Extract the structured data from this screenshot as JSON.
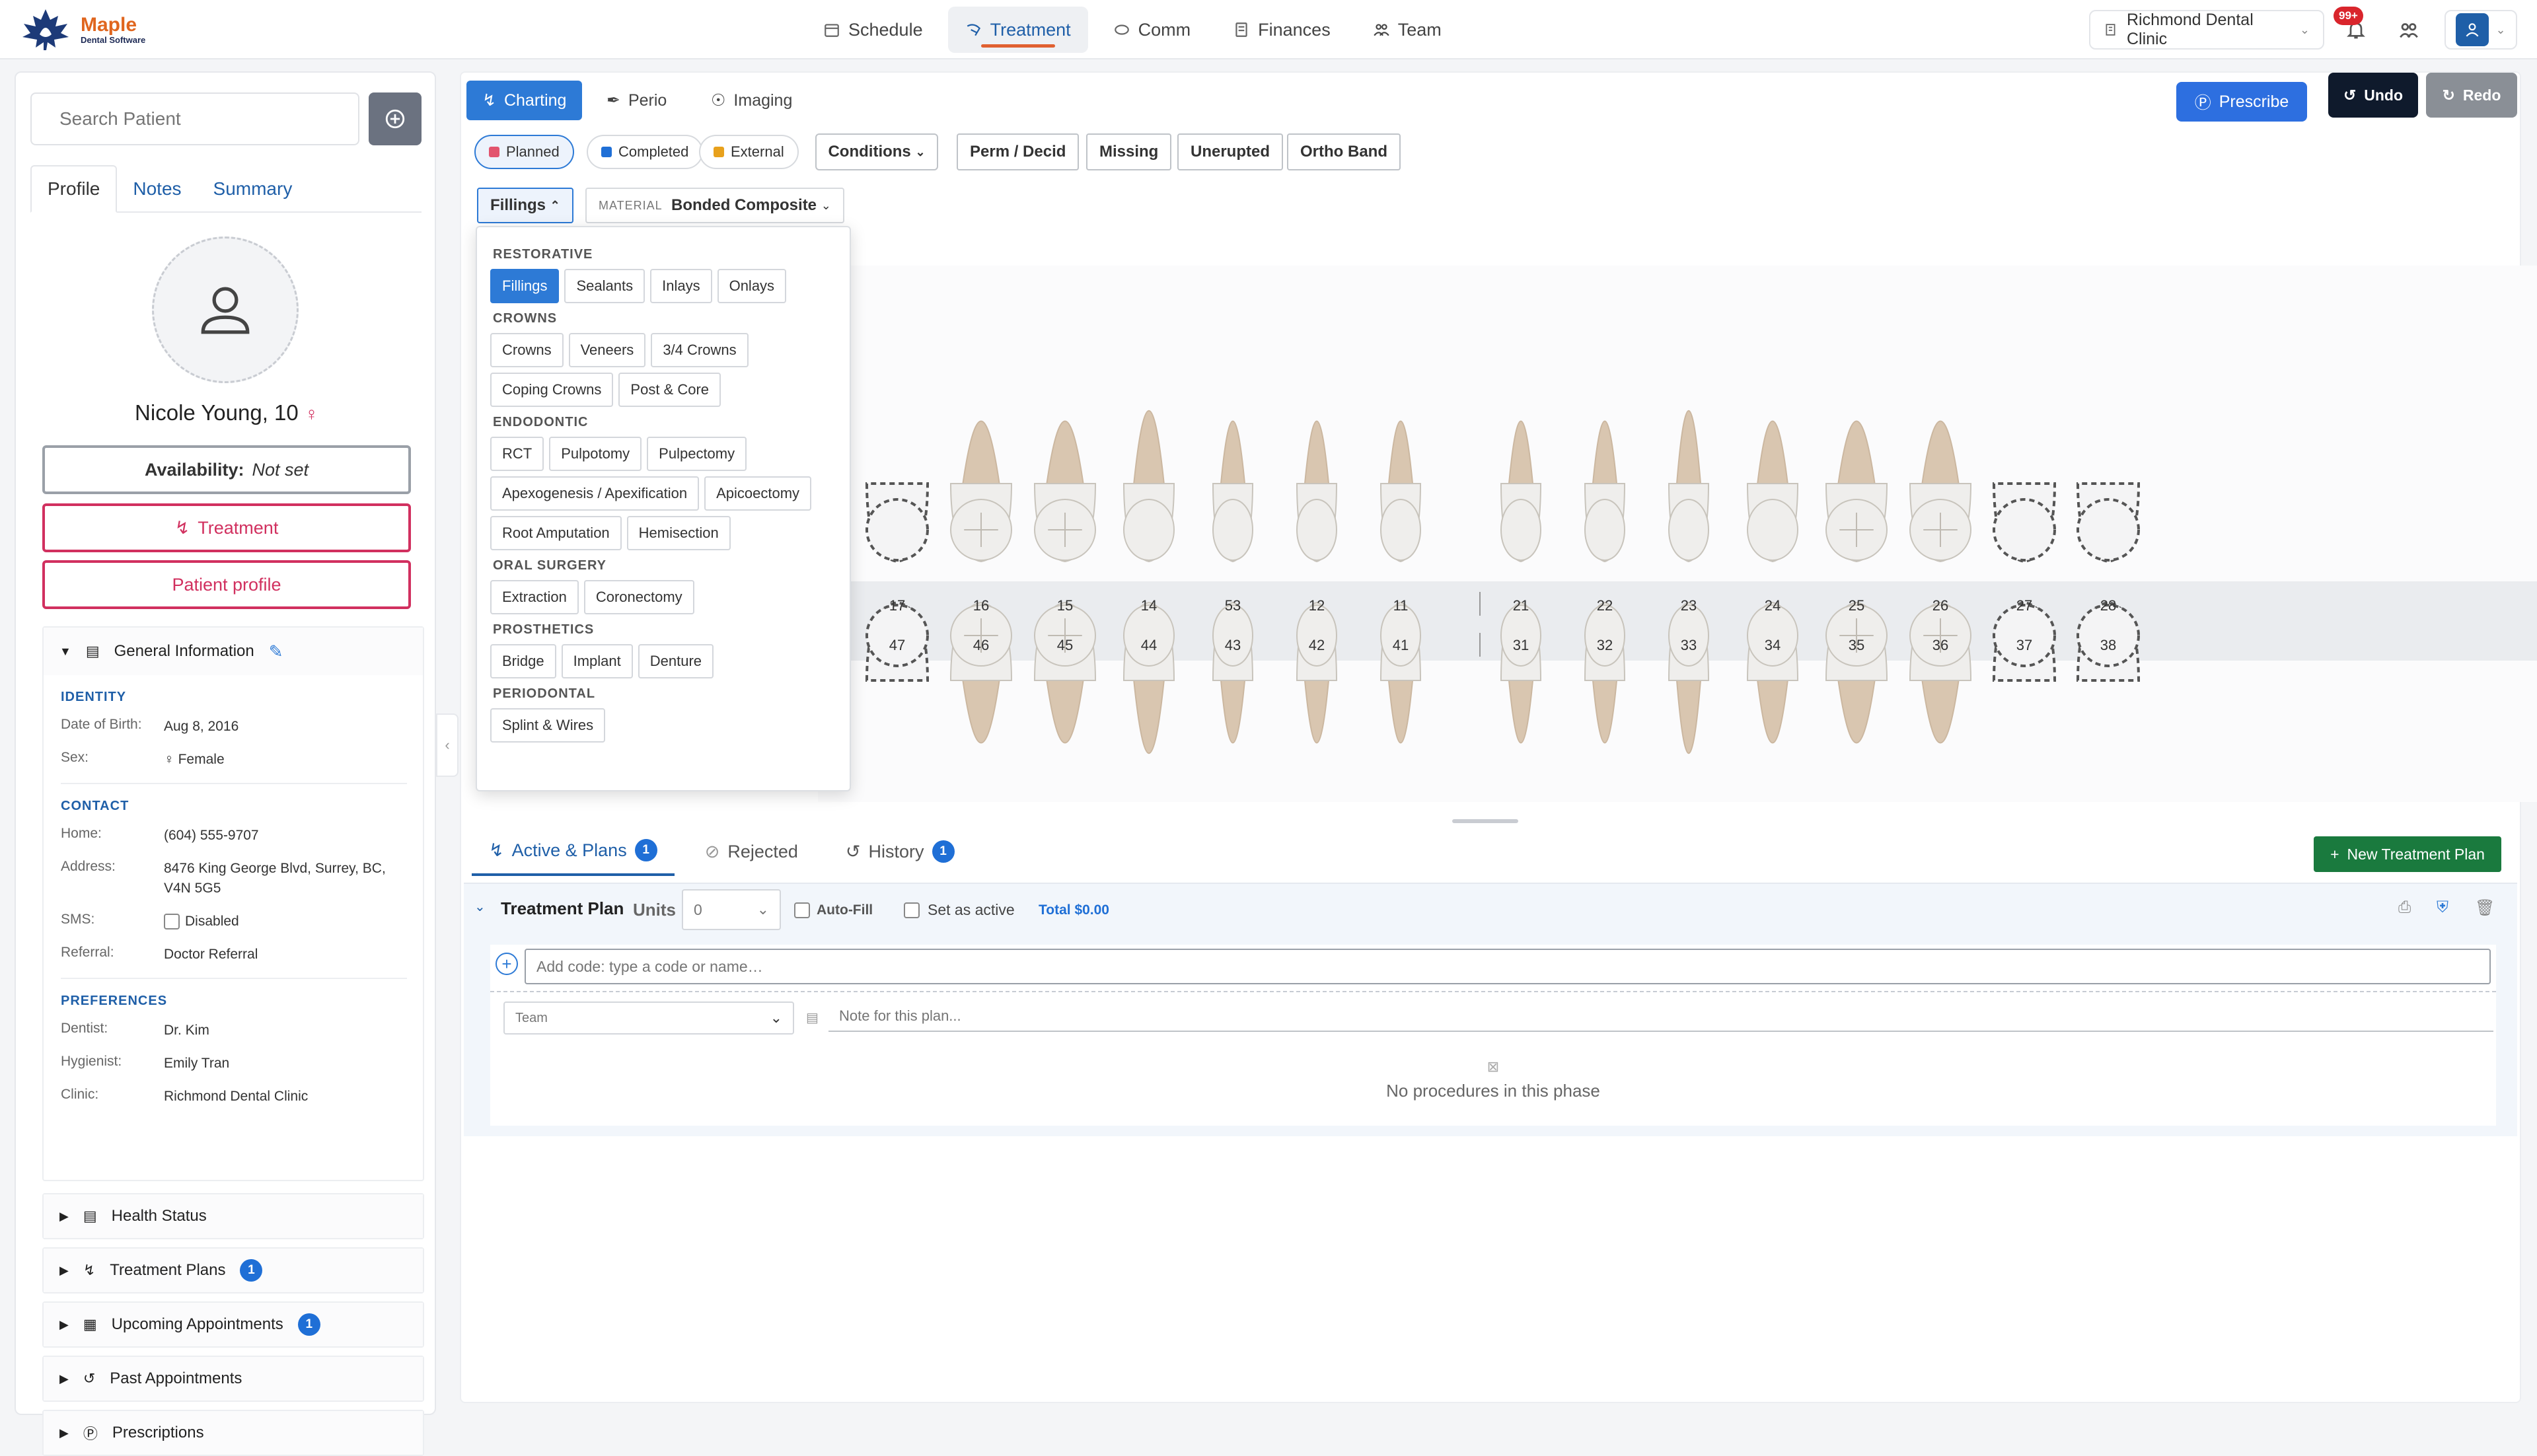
{
  "brand": {
    "name": "Maple",
    "sub": "Dental Software"
  },
  "nav": {
    "tabs": [
      {
        "label": "Schedule",
        "icon": "calendar-icon"
      },
      {
        "label": "Treatment",
        "icon": "tooth-icon"
      },
      {
        "label": "Comm",
        "icon": "chat-icon"
      },
      {
        "label": "Finances",
        "icon": "ledger-icon"
      },
      {
        "label": "Team",
        "icon": "team-icon"
      }
    ],
    "active": "Treatment",
    "clinic": "Richmond Dental Clinic",
    "notif_badge": "99+"
  },
  "patient": {
    "search_placeholder": "Search Patient",
    "tabs": [
      "Profile",
      "Notes",
      "Summary"
    ],
    "name": "Nicole Young, 10",
    "availability_label": "Availability:",
    "availability_value": "Not set",
    "treatment_btn": "Treatment",
    "profile_btn": "Patient profile"
  },
  "general": {
    "title": "General Information",
    "identity": {
      "title": "IDENTITY",
      "dob_k": "Date of Birth:",
      "dob": "Aug 8, 2016",
      "sex_k": "Sex:",
      "sex": "Female"
    },
    "contact": {
      "title": "CONTACT",
      "home_k": "Home:",
      "home": "(604) 555-9707",
      "addr_k": "Address:",
      "addr": "8476 King George Blvd, Surrey, BC, V4N 5G5",
      "sms_k": "SMS:",
      "sms": "Disabled",
      "ref_k": "Referral:",
      "ref": "Doctor Referral"
    },
    "prefs": {
      "title": "PREFERENCES",
      "dentist_k": "Dentist:",
      "dentist": "Dr. Kim",
      "hyg_k": "Hygienist:",
      "hyg": "Emily Tran",
      "clinic_k": "Clinic:",
      "clinic": "Richmond Dental Clinic"
    }
  },
  "sections": [
    {
      "label": "Health Status",
      "count": ""
    },
    {
      "label": "Treatment Plans",
      "count": "1"
    },
    {
      "label": "Upcoming Appointments",
      "count": "1"
    },
    {
      "label": "Past Appointments",
      "count": ""
    },
    {
      "label": "Prescriptions",
      "count": ""
    }
  ],
  "main": {
    "tabs": [
      "Charting",
      "Perio",
      "Imaging"
    ],
    "prescribe": "Prescribe",
    "undo": "Undo",
    "redo": "Redo",
    "chips": [
      {
        "label": "Planned",
        "color": "#e2546e"
      },
      {
        "label": "Completed",
        "color": "#1f6fd6"
      },
      {
        "label": "External",
        "color": "#e8a11c"
      }
    ],
    "conditions": "Conditions",
    "tools": [
      "Perm / Decid",
      "Missing",
      "Unerupted",
      "Ortho Band"
    ],
    "fillings": "Fillings",
    "material_label": "MATERIAL",
    "material": "Bonded Composite"
  },
  "dropdown": [
    {
      "title": "RESTORATIVE",
      "items": [
        "Fillings",
        "Sealants",
        "Inlays",
        "Onlays"
      ],
      "active": "Fillings"
    },
    {
      "title": "CROWNS",
      "items": [
        "Crowns",
        "Veneers",
        "3/4 Crowns",
        "Coping Crowns",
        "Post & Core"
      ]
    },
    {
      "title": "ENDODONTIC",
      "items": [
        "RCT",
        "Pulpotomy",
        "Pulpectomy",
        "Apexogenesis / Apexification",
        "Apicoectomy",
        "Root Amputation",
        "Hemisection"
      ]
    },
    {
      "title": "ORAL SURGERY",
      "items": [
        "Extraction",
        "Coronectomy"
      ]
    },
    {
      "title": "PROSTHETICS",
      "items": [
        "Bridge",
        "Implant",
        "Denture"
      ]
    },
    {
      "title": "PERIODONTAL",
      "items": [
        "Splint & Wires"
      ]
    }
  ],
  "teeth": {
    "upper": [
      "17",
      "16",
      "15",
      "14",
      "53",
      "12",
      "11",
      "21",
      "22",
      "23",
      "24",
      "25",
      "26",
      "27",
      "28"
    ],
    "lower": [
      "47",
      "46",
      "45",
      "44",
      "43",
      "42",
      "41",
      "31",
      "32",
      "33",
      "34",
      "35",
      "36",
      "37",
      "38"
    ]
  },
  "plan": {
    "tabs": [
      {
        "label": "Active & Plans",
        "count": "1"
      },
      {
        "label": "Rejected",
        "count": ""
      },
      {
        "label": "History",
        "count": "1"
      }
    ],
    "new_btn": "New Treatment Plan",
    "title": "Treatment Plan",
    "units_label": "Units",
    "units": "0",
    "autofill": "Auto-Fill",
    "set_active": "Set as active",
    "total": "Total $0.00",
    "code_placeholder": "Add code: type a code or name…",
    "team_label": "Team",
    "note_placeholder": "Note for this plan...",
    "empty": "No procedures in this phase"
  }
}
